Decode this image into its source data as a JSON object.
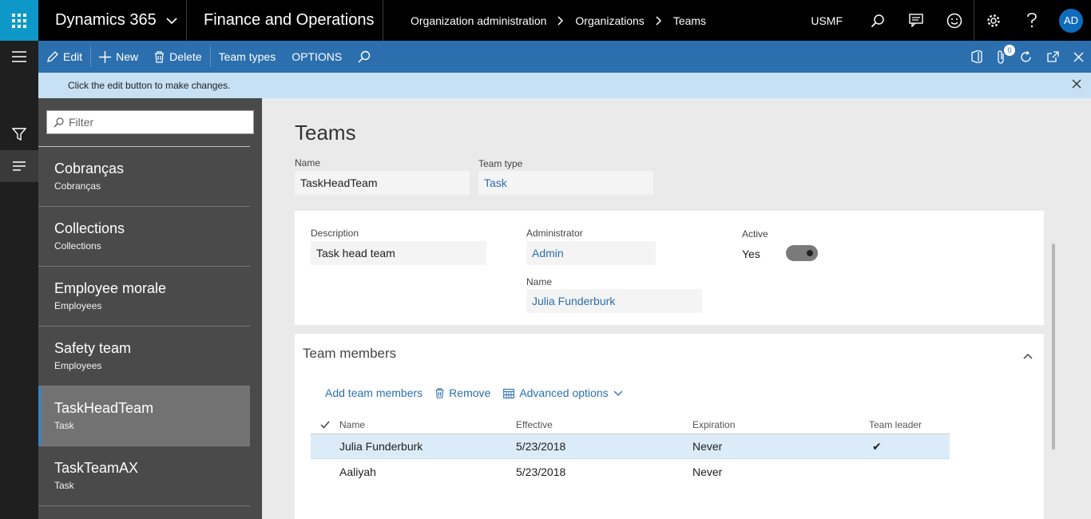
{
  "topbar": {
    "brand": "Dynamics 365",
    "app": "Finance and Operations",
    "breadcrumb": [
      "Organization administration",
      "Organizations",
      "Teams"
    ],
    "company": "USMF",
    "avatar_initials": "AD"
  },
  "actionpane": {
    "edit": "Edit",
    "new": "New",
    "delete": "Delete",
    "team_types": "Team types",
    "options": "OPTIONS",
    "notification_count": "0"
  },
  "message": "Click the edit button to make changes.",
  "list": {
    "filter_placeholder": "Filter",
    "items": [
      {
        "title": "Cobranças",
        "sub": "Cobranças"
      },
      {
        "title": "Collections",
        "sub": "Collections"
      },
      {
        "title": "Employee morale",
        "sub": "Employees"
      },
      {
        "title": "Safety team",
        "sub": "Employees"
      },
      {
        "title": "TaskHeadTeam",
        "sub": "Task"
      },
      {
        "title": "TaskTeamAX",
        "sub": "Task"
      }
    ],
    "selected_index": 4
  },
  "form": {
    "title": "Teams",
    "name_label": "Name",
    "name_value": "TaskHeadTeam",
    "teamtype_label": "Team type",
    "teamtype_value": "Task",
    "description_label": "Description",
    "description_value": "Task head team",
    "administrator_label": "Administrator",
    "administrator_value": "Admin",
    "admin_name_label": "Name",
    "admin_name_value": "Julia Funderburk",
    "active_label": "Active",
    "active_value": "Yes"
  },
  "members": {
    "title": "Team members",
    "add": "Add team members",
    "remove": "Remove",
    "advanced": "Advanced options",
    "columns": [
      "Name",
      "Effective",
      "Expiration",
      "Team leader"
    ],
    "rows": [
      {
        "name": "Julia Funderburk",
        "effective": "5/23/2018",
        "expiration": "Never",
        "leader": "✔"
      },
      {
        "name": "Aaliyah",
        "effective": "5/23/2018",
        "expiration": "Never",
        "leader": ""
      }
    ]
  }
}
